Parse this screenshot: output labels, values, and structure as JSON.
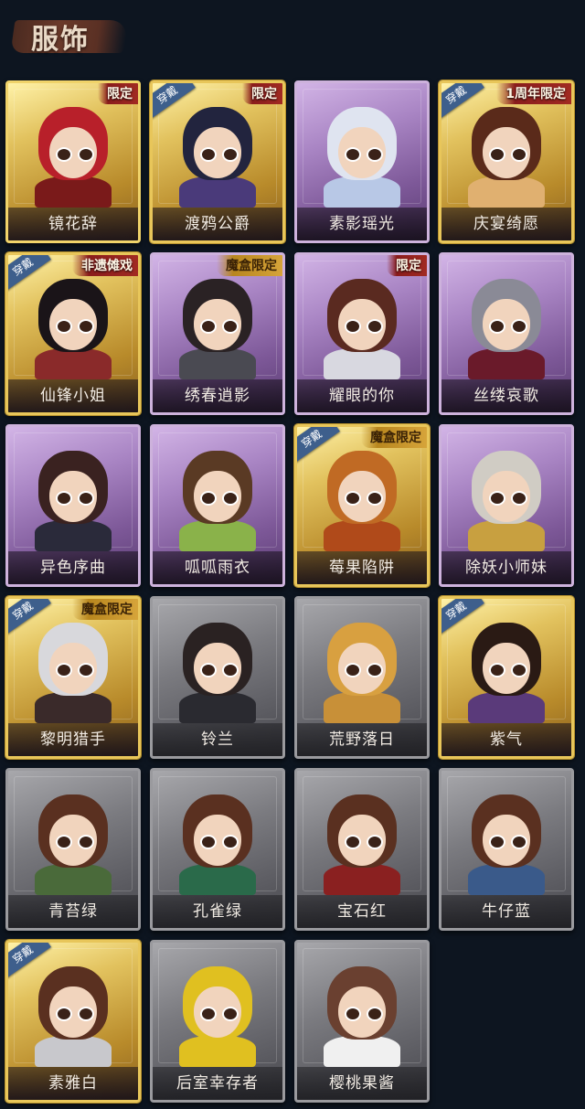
{
  "header": {
    "title": "服饰"
  },
  "equipped_label": "穿戴",
  "costumes": [
    {
      "name": "镜花辞",
      "tier": "gold",
      "tag": "限定",
      "tag_style": "red",
      "equipped": false,
      "hair": "#b8202a",
      "outfit": "#7a1a1a"
    },
    {
      "name": "渡鸦公爵",
      "tier": "gold",
      "tag": "限定",
      "tag_style": "red",
      "equipped": true,
      "hair": "#22243e",
      "outfit": "#4a3a7a"
    },
    {
      "name": "素影瑶光",
      "tier": "purple",
      "tag": "",
      "tag_style": "",
      "equipped": false,
      "hair": "#dfe4f0",
      "outfit": "#b8c8e6"
    },
    {
      "name": "庆宴绮愿",
      "tier": "gold",
      "tag": "1周年限定",
      "tag_style": "red",
      "equipped": true,
      "hair": "#5a2a1a",
      "outfit": "#e0b070"
    },
    {
      "name": "仙锋小姐",
      "tier": "gold",
      "tag": "非遗傩戏",
      "tag_style": "red",
      "equipped": true,
      "hair": "#1a1418",
      "outfit": "#8a2a2a"
    },
    {
      "name": "绣春逍影",
      "tier": "purple",
      "tag": "魔盒限定",
      "tag_style": "gold",
      "equipped": false,
      "hair": "#2a2224",
      "outfit": "#4a4a52"
    },
    {
      "name": "耀眼的你",
      "tier": "purple",
      "tag": "限定",
      "tag_style": "red",
      "equipped": false,
      "hair": "#5a2a20",
      "outfit": "#d8d8e0"
    },
    {
      "name": "丝缕哀歌",
      "tier": "purple",
      "tag": "",
      "tag_style": "",
      "equipped": false,
      "hair": "#8a8a96",
      "outfit": "#6a1a2a"
    },
    {
      "name": "异色序曲",
      "tier": "purple",
      "tag": "",
      "tag_style": "",
      "equipped": false,
      "hair": "#3a2220",
      "outfit": "#2a2a3a"
    },
    {
      "name": "呱呱雨衣",
      "tier": "purple",
      "tag": "",
      "tag_style": "",
      "equipped": false,
      "hair": "#5a3a24",
      "outfit": "#8ab24a"
    },
    {
      "name": "莓果陷阱",
      "tier": "gold",
      "tag": "魔盒限定",
      "tag_style": "gold",
      "equipped": true,
      "hair": "#c06a24",
      "outfit": "#b04a1a"
    },
    {
      "name": "除妖小师妹",
      "tier": "purple",
      "tag": "",
      "tag_style": "",
      "equipped": false,
      "hair": "#d0ccc4",
      "outfit": "#c8a040"
    },
    {
      "name": "黎明猎手",
      "tier": "gold",
      "tag": "魔盒限定",
      "tag_style": "gold",
      "equipped": true,
      "hair": "#d8d8dc",
      "outfit": "#3a2a2a"
    },
    {
      "name": "铃兰",
      "tier": "gray",
      "tag": "",
      "tag_style": "",
      "equipped": false,
      "hair": "#2a2222",
      "outfit": "#2a2a30"
    },
    {
      "name": "荒野落日",
      "tier": "gray",
      "tag": "",
      "tag_style": "",
      "equipped": false,
      "hair": "#d8a040",
      "outfit": "#c89038"
    },
    {
      "name": "紫气",
      "tier": "gold",
      "tag": "",
      "tag_style": "",
      "equipped": true,
      "hair": "#2a1a14",
      "outfit": "#5a3a7a"
    },
    {
      "name": "青苔绿",
      "tier": "gray",
      "tag": "",
      "tag_style": "",
      "equipped": false,
      "hair": "#5a3020",
      "outfit": "#4a6a3a"
    },
    {
      "name": "孔雀绿",
      "tier": "gray",
      "tag": "",
      "tag_style": "",
      "equipped": false,
      "hair": "#5a3020",
      "outfit": "#2a6a4a"
    },
    {
      "name": "宝石红",
      "tier": "gray",
      "tag": "",
      "tag_style": "",
      "equipped": false,
      "hair": "#5a3020",
      "outfit": "#8a2020"
    },
    {
      "name": "牛仔蓝",
      "tier": "gray",
      "tag": "",
      "tag_style": "",
      "equipped": false,
      "hair": "#5a3020",
      "outfit": "#3a5a8a"
    },
    {
      "name": "素雅白",
      "tier": "gold",
      "tag": "",
      "tag_style": "",
      "equipped": true,
      "hair": "#5a3020",
      "outfit": "#c8c8cc"
    },
    {
      "name": "后室幸存者",
      "tier": "gray",
      "tag": "",
      "tag_style": "",
      "equipped": false,
      "hair": "#e0c020",
      "outfit": "#e0c020"
    },
    {
      "name": "樱桃果酱",
      "tier": "gray",
      "tag": "",
      "tag_style": "",
      "equipped": false,
      "hair": "#6a4030",
      "outfit": "#f0f0f0"
    }
  ]
}
